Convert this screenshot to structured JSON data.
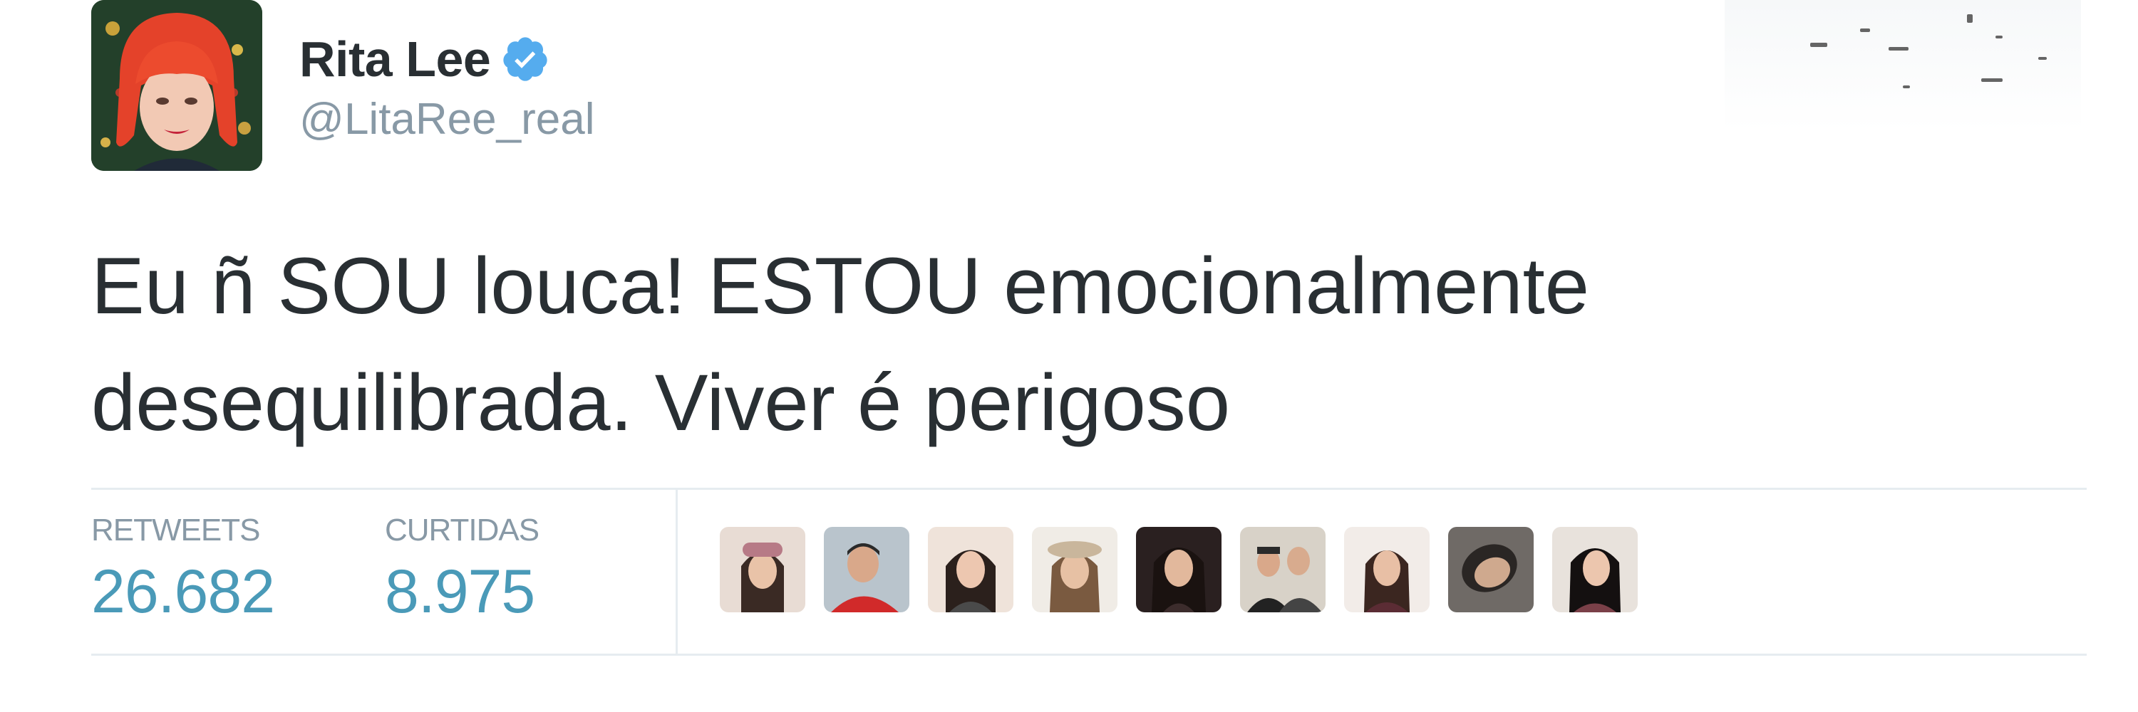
{
  "author": {
    "display_name": "Rita Lee",
    "handle": "@LitaRee_real",
    "verified": true,
    "avatar_icon": "profile-avatar"
  },
  "tweet": {
    "text": "Eu ñ SOU louca! ESTOU emocionalmente\ndesequilibrada. Viver é perigoso"
  },
  "stats": {
    "retweets": {
      "label": "RETWEETS",
      "value": "26.682"
    },
    "likes": {
      "label": "CURTIDAS",
      "value": "8.975"
    }
  },
  "likers": [
    {
      "name": "liker-avatar"
    },
    {
      "name": "liker-avatar"
    },
    {
      "name": "liker-avatar"
    },
    {
      "name": "liker-avatar"
    },
    {
      "name": "liker-avatar"
    },
    {
      "name": "liker-avatar"
    },
    {
      "name": "liker-avatar"
    },
    {
      "name": "liker-avatar"
    },
    {
      "name": "liker-avatar"
    }
  ],
  "colors": {
    "text": "#292f33",
    "muted": "#8899a6",
    "stat_value": "#4a9ab8",
    "verified_badge": "#1da1f2",
    "divider": "#e6ecf0"
  }
}
